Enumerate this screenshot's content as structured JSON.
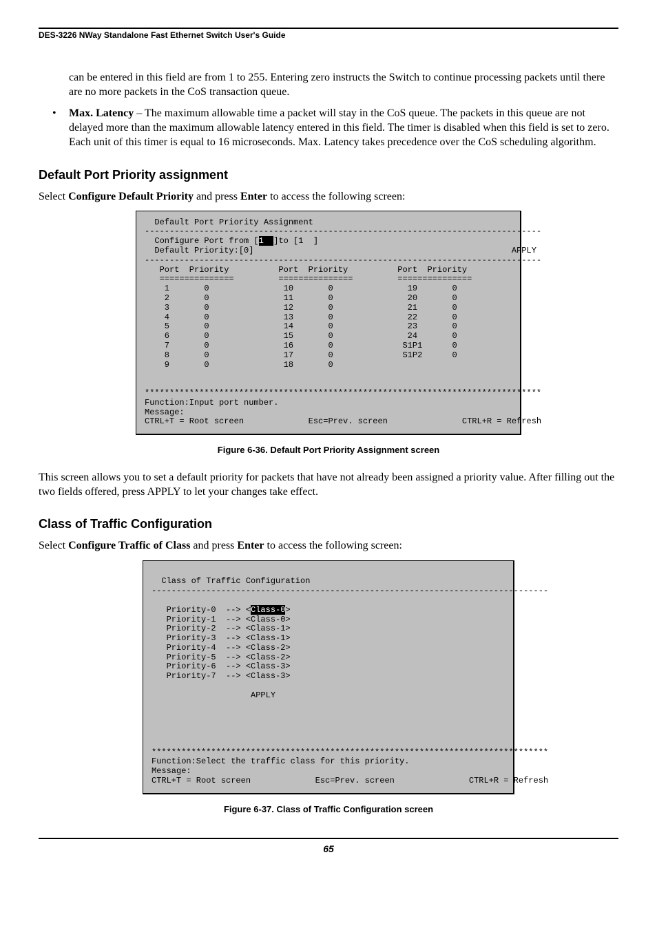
{
  "header": {
    "title": "DES-3226 NWay Standalone Fast Ethernet Switch User's Guide"
  },
  "intro_para": "can be entered in this field are from 1 to 255. Entering zero instructs the Switch to continue processing packets until there are no more packets in the CoS transaction queue.",
  "bullet": {
    "term": "Max. Latency",
    "body": " – The maximum allowable time a packet will stay in the CoS queue. The packets in this queue are not delayed more than the maximum allowable latency entered in this field. The timer is disabled when this field is set to zero. Each unit of this timer is equal to 16 microseconds. Max. Latency takes precedence over the CoS scheduling algorithm."
  },
  "section1": {
    "heading": "Default Port Priority assignment",
    "lead_pre": "Select ",
    "lead_bold1": "Configure Default Priority",
    "lead_mid": " and press ",
    "lead_bold2": "Enter",
    "lead_post": " to access the following screen:",
    "screen": {
      "line01": "  Default Port Priority Assignment",
      "line02": "--------------------------------------------------------------------------------",
      "line03_a": "  Configure Port from [",
      "line03_hl": "1  ",
      "line03_b": "]to [1  ]",
      "line04": "  Default Priority:[0]                                                    APPLY",
      "line05": "--------------------------------------------------------------------------------",
      "line06": "   Port  Priority          Port  Priority          Port  Priority",
      "line07": "   ===============         ===============         ===============",
      "line08": "    1       0               10       0               19       0",
      "line09": "    2       0               11       0               20       0",
      "line10": "    3       0               12       0               21       0",
      "line11": "    4       0               13       0               22       0",
      "line12": "    5       0               14       0               23       0",
      "line13": "    6       0               15       0               24       0",
      "line14": "    7       0               16       0              S1P1      0",
      "line15": "    8       0               17       0              S1P2      0",
      "line16": "    9       0               18       0",
      "line17": "",
      "line18": "",
      "line19": "********************************************************************************",
      "line20": "Function:Input port number.",
      "line21": "Message:",
      "line22": "CTRL+T = Root screen             Esc=Prev. screen               CTRL+R = Refresh"
    },
    "caption": "Figure 6-36.  Default Port Priority Assignment screen",
    "after": "This screen allows you to set a default priority for packets that have not already been assigned a priority value. After filling out the two fields offered, press APPLY to let your changes take effect."
  },
  "section2": {
    "heading": "Class of Traffic Configuration",
    "lead_pre": "Select ",
    "lead_bold1": "Configure Traffic of Class",
    "lead_mid": " and press ",
    "lead_bold2": "Enter",
    "lead_post": " to access the following screen:",
    "screen": {
      "line01": "",
      "line02": "  Class of Traffic Configuration",
      "line03": "--------------------------------------------------------------------------------",
      "line04": "",
      "line05_a": "   Priority-0  --> <",
      "line05_hl": "Class-0",
      "line05_b": ">",
      "line06": "   Priority-1  --> <Class-0>",
      "line07": "   Priority-2  --> <Class-1>",
      "line08": "   Priority-3  --> <Class-1>",
      "line09": "   Priority-4  --> <Class-2>",
      "line10": "   Priority-5  --> <Class-2>",
      "line11": "   Priority-6  --> <Class-3>",
      "line12": "   Priority-7  --> <Class-3>",
      "line13": "",
      "line14": "                    APPLY",
      "line15": "",
      "line16": "",
      "line17": "",
      "line18": "",
      "line19": "",
      "line20": "********************************************************************************",
      "line21": "Function:Select the traffic class for this priority.",
      "line22": "Message:",
      "line23": "CTRL+T = Root screen             Esc=Prev. screen               CTRL+R = Refresh"
    },
    "caption": "Figure 6-37.  Class of Traffic Configuration screen"
  },
  "footer": {
    "page": "65"
  }
}
